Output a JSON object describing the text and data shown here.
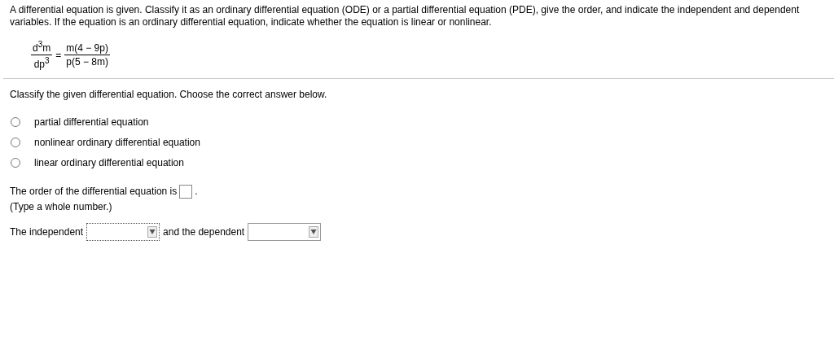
{
  "instructions": "A differential equation is given. Classify it as an ordinary differential equation (ODE) or a partial differential equation (PDE), give the order, and indicate the independent and dependent variables. If the equation is an ordinary differential equation, indicate whether the equation is linear or nonlinear.",
  "equation": {
    "left": {
      "numerator": "d$^{3}$m",
      "denominator": "dp$^{3}$"
    },
    "operator": "=",
    "right": {
      "numerator": "m(4 − 9p)",
      "denominator": "p(5 − 8m)"
    }
  },
  "question": "Classify the given differential equation. Choose the correct answer below.",
  "options": [
    {
      "label": "partial differential equation",
      "selected": false
    },
    {
      "label": "nonlinear ordinary differential equation",
      "selected": false
    },
    {
      "label": "linear ordinary differential equation",
      "selected": false
    }
  ],
  "order": {
    "prompt": "The order of the differential equation is",
    "suffix": ".",
    "hint": "(Type a whole number.)"
  },
  "variables": {
    "prefix": "The independent",
    "middle": "and the dependent",
    "dropdowns": [
      {
        "focused": true
      },
      {
        "focused": false
      }
    ]
  }
}
